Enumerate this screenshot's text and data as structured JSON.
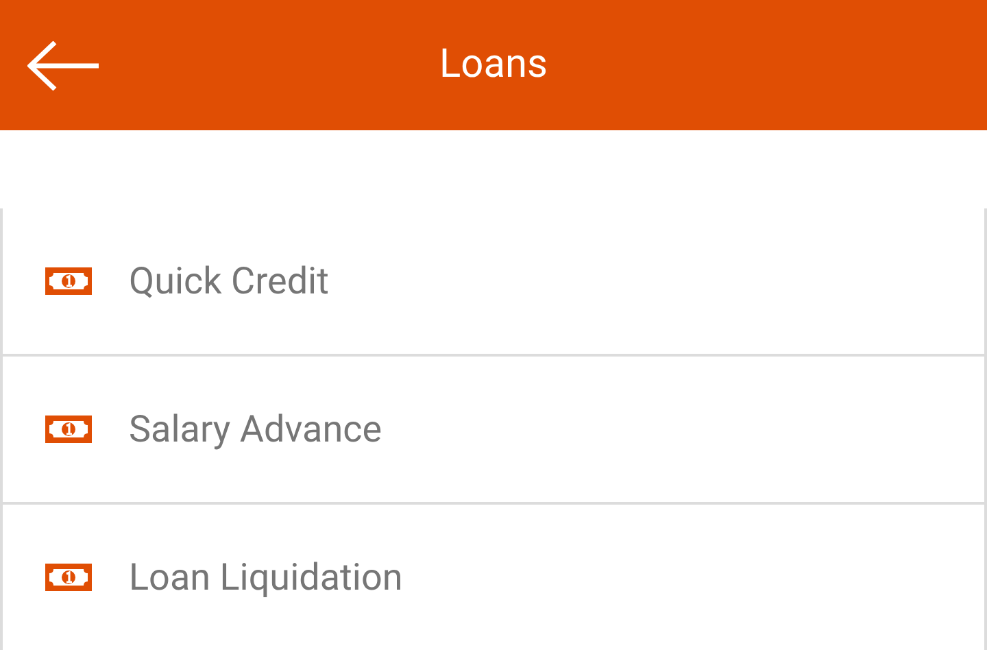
{
  "header": {
    "title": "Loans"
  },
  "items": [
    {
      "label": "Quick Credit"
    },
    {
      "label": "Salary Advance"
    },
    {
      "label": "Loan Liquidation"
    }
  ]
}
